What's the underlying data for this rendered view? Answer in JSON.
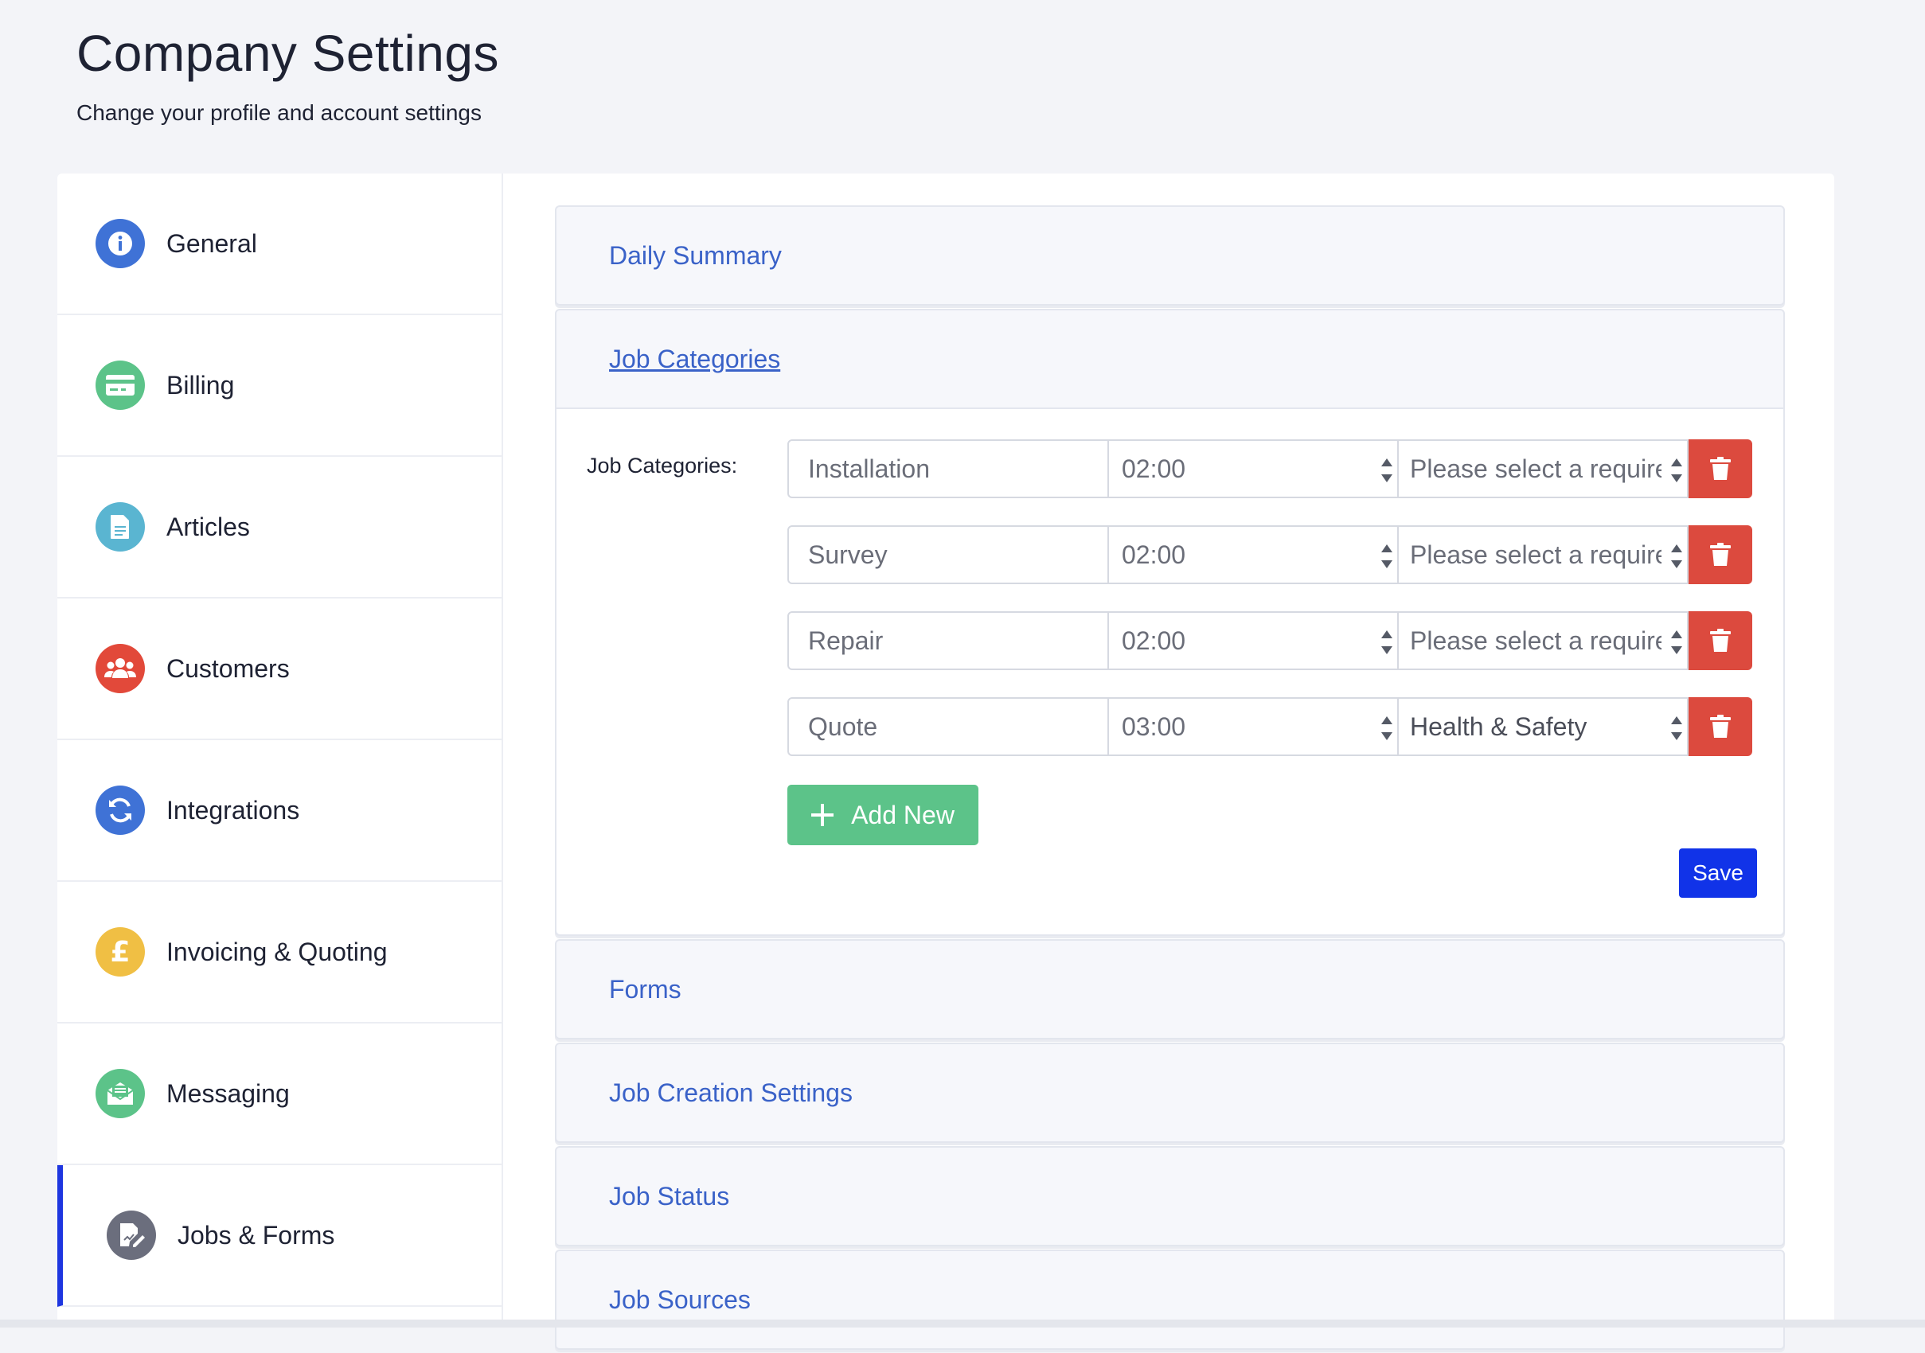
{
  "header": {
    "title": "Company Settings",
    "subtitle": "Change your profile and account settings"
  },
  "sidebar": {
    "items": [
      {
        "label": "General",
        "icon": "info-icon",
        "color": "#3f72d6"
      },
      {
        "label": "Billing",
        "icon": "credit-card-icon",
        "color": "#5cc389"
      },
      {
        "label": "Articles",
        "icon": "document-icon",
        "color": "#5ab5d1"
      },
      {
        "label": "Customers",
        "icon": "users-icon",
        "color": "#e2493a"
      },
      {
        "label": "Integrations",
        "icon": "sync-icon",
        "color": "#3f72d6"
      },
      {
        "label": "Invoicing & Quoting",
        "icon": "pound-icon",
        "color": "#f0bf44"
      },
      {
        "label": "Messaging",
        "icon": "envelope-icon",
        "color": "#5cc389"
      },
      {
        "label": "Jobs & Forms",
        "icon": "edit-document-icon",
        "color": "#6b6e7d",
        "active": true
      }
    ]
  },
  "panels": {
    "daily_summary": "Daily Summary",
    "job_categories": "Job Categories",
    "forms": "Forms",
    "job_creation": "Job Creation Settings",
    "job_status": "Job Status",
    "job_sources": "Job Sources"
  },
  "job_categories": {
    "label": "Job Categories:",
    "rows": [
      {
        "name": "Installation",
        "time": "02:00",
        "requirement": "Please select a requirement"
      },
      {
        "name": "Survey",
        "time": "02:00",
        "requirement": "Please select a requirement"
      },
      {
        "name": "Repair",
        "time": "02:00",
        "requirement": "Please select a requirement"
      },
      {
        "name": "Quote",
        "time": "03:00",
        "requirement": "Health & Safety"
      }
    ],
    "add_label": "Add New",
    "save_label": "Save"
  },
  "colors": {
    "link": "#3a62c8",
    "delete": "#dc4a3e",
    "add": "#5cc389",
    "save": "#1133e8",
    "active_bar": "#1e36e0"
  }
}
